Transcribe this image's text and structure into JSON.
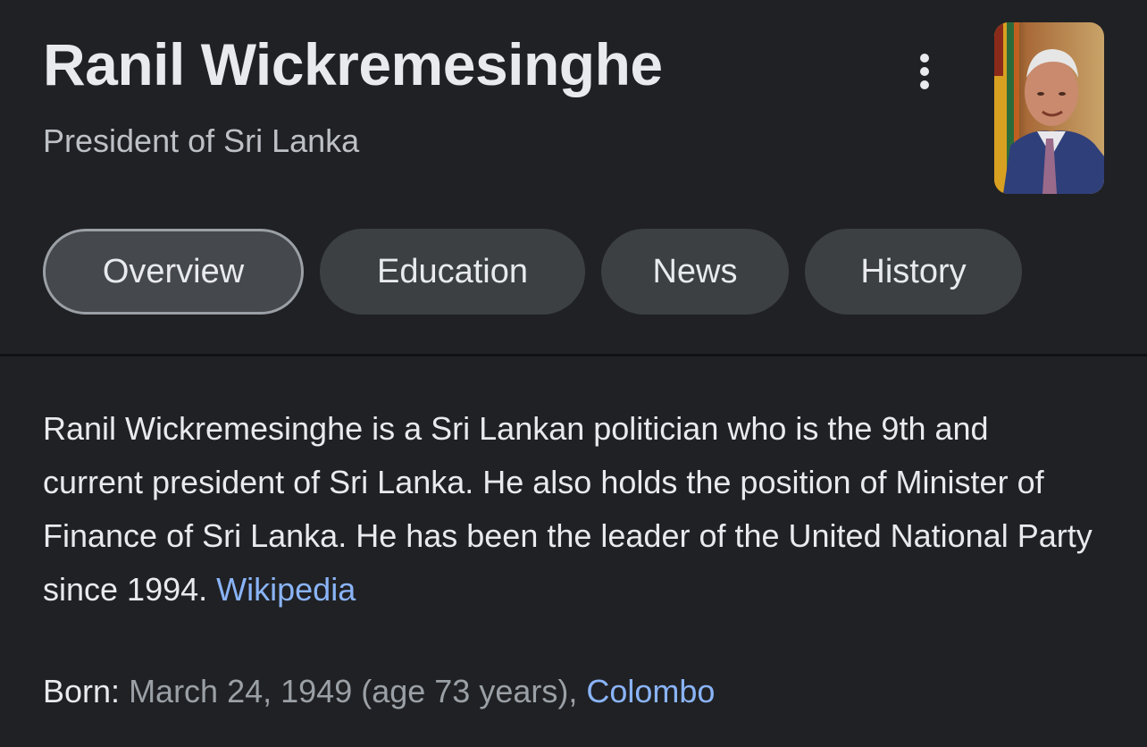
{
  "header": {
    "title": "Ranil Wickremesinghe",
    "subtitle": "President of Sri Lanka",
    "more_icon": "more-vert-icon"
  },
  "thumbnail": {
    "alt": "Ranil Wickremesinghe"
  },
  "tabs": [
    {
      "label": "Overview",
      "active": true
    },
    {
      "label": "Education",
      "active": false
    },
    {
      "label": "News",
      "active": false
    },
    {
      "label": "History",
      "active": false
    }
  ],
  "description": {
    "text": "Ranil Wickremesinghe is a Sri Lankan politician who is the 9th and current president of Sri Lanka. He also holds the position of Minister of Finance of Sri Lanka. He has been the leader of the United National Party since 1994.",
    "source_link": "Wikipedia"
  },
  "facts": {
    "born": {
      "label": "Born:",
      "value": "March 24, 1949 (age 73 years),",
      "place_link": "Colombo"
    }
  },
  "colors": {
    "background": "#202124",
    "text_primary": "#e8eaed",
    "text_secondary": "#9aa0a6",
    "link": "#8ab4f8",
    "chip": "#3c4043"
  }
}
